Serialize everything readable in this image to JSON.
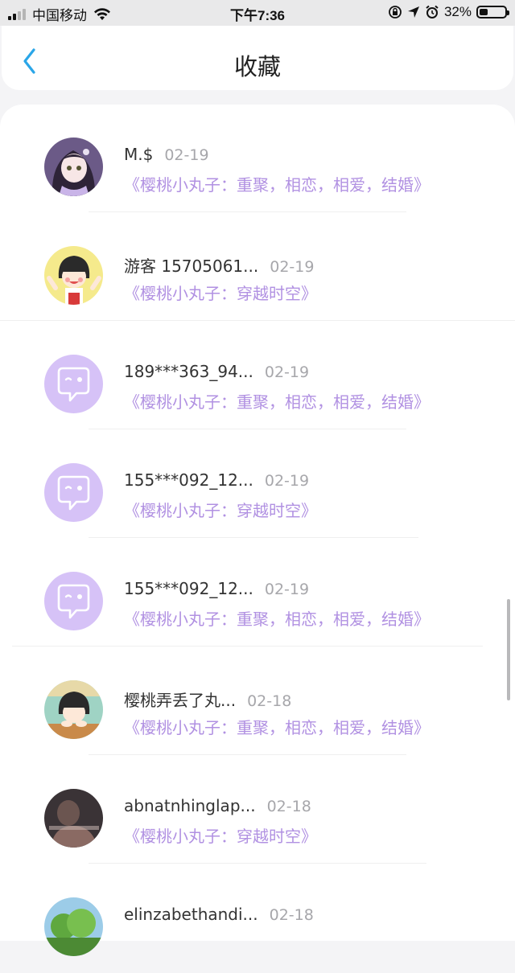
{
  "status_bar": {
    "carrier": "中国移动",
    "time": "下午7:36",
    "battery_percent": "32%",
    "battery_level": 0.32
  },
  "header": {
    "title": "收藏",
    "back_icon": "chevron-left-icon"
  },
  "colors": {
    "accent_purple": "#b191e2",
    "avatar_placeholder": "#d6c2f7",
    "back_blue": "#2aa6e8"
  },
  "items": [
    {
      "name": "M.$",
      "date": "02-19",
      "work": "《樱桃小丸子：重聚，相恋，相爱，结婚》",
      "avatar": "anime-girl-avatar"
    },
    {
      "name": "游客 15705061...",
      "date": "02-19",
      "work": "《樱桃小丸子：穿越时空》",
      "avatar": "maruko-avatar"
    },
    {
      "name": "189***363_94...",
      "date": "02-19",
      "work": "《樱桃小丸子：重聚，相恋，相爱，结婚》",
      "avatar": "default-avatar"
    },
    {
      "name": "155***092_12...",
      "date": "02-19",
      "work": "《樱桃小丸子：穿越时空》",
      "avatar": "default-avatar"
    },
    {
      "name": "155***092_12...",
      "date": "02-19",
      "work": "《樱桃小丸子：重聚，相恋，相爱，结婚》",
      "avatar": "default-avatar"
    },
    {
      "name": "樱桃弄丢了丸...",
      "date": "02-18",
      "work": "《樱桃小丸子：重聚，相恋，相爱，结婚》",
      "avatar": "maruko-desk-avatar"
    },
    {
      "name": "abnatnhinglap...",
      "date": "02-18",
      "work": "《樱桃小丸子：穿越时空》",
      "avatar": "dark-photo-avatar"
    },
    {
      "name": "elinzabethandi...",
      "date": "02-18",
      "work": "",
      "avatar": "nature-avatar"
    }
  ]
}
